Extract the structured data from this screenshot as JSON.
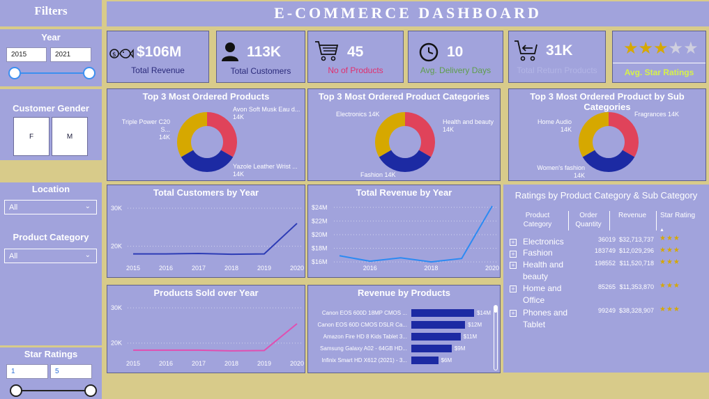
{
  "filters": {
    "title": "Filters",
    "year": {
      "label": "Year",
      "from": "2015",
      "to": "2021"
    },
    "gender": {
      "label": "Customer Gender",
      "options": [
        "F",
        "M"
      ]
    },
    "location": {
      "label": "Location",
      "value": "All"
    },
    "category": {
      "label": "Product Category",
      "value": "All"
    },
    "stars": {
      "label": "Star Ratings",
      "from": "1",
      "to": "5"
    }
  },
  "header": {
    "title": "E-COMMERCE DASHBOARD"
  },
  "kpis": [
    {
      "value": "$106M",
      "label": "Total Revenue",
      "icon": "fish-icon"
    },
    {
      "value": "113K",
      "label": "Total Customers",
      "icon": "user-icon"
    },
    {
      "value": "45",
      "label": "No of Products",
      "icon": "cart-icon"
    },
    {
      "value": "10",
      "label": "Avg. Delivery Days",
      "icon": "clock-icon"
    },
    {
      "value": "31K",
      "label": "Total Return Products",
      "icon": "return-cart-icon"
    },
    {
      "label": "Avg. Star Ratings",
      "stars_filled": 3,
      "stars_total": 5
    }
  ],
  "colors": {
    "panel": "#a1a3dc",
    "background": "#d8cb8a",
    "red": "#e0435a",
    "blue": "#1c2aa3",
    "gold": "#d6a800",
    "pink": "#e14eb0",
    "line_blue": "#2b8af3"
  },
  "donuts": [
    {
      "title": "Top 3 Most Ordered Products",
      "labels": [
        {
          "name": "Avon Soft Musk Eau d...",
          "value": "14K"
        },
        {
          "name": "Yazole Leather Wrist ...",
          "value": "14K"
        },
        {
          "name": "Triple Power C20 S...",
          "value": "14K"
        }
      ]
    },
    {
      "title": "Top 3 Most Ordered Product Categories",
      "labels": [
        {
          "name": "Health and beauty",
          "value": "14K"
        },
        {
          "name": "Fashion",
          "value": "14K"
        },
        {
          "name": "Electronics",
          "value": "14K"
        }
      ]
    },
    {
      "title": "Top 3 Most Ordered Product by Sub Categories",
      "labels": [
        {
          "name": "Fragrances",
          "value": "14K"
        },
        {
          "name": "Women's fashion",
          "value": "14K"
        },
        {
          "name": "Home Audio",
          "value": "14K"
        }
      ]
    }
  ],
  "chart_data": [
    {
      "type": "line",
      "title": "Total Customers by Year",
      "x": [
        2015,
        2016,
        2017,
        2018,
        2019,
        2020
      ],
      "series": [
        {
          "values": [
            18000,
            18000,
            18100,
            17900,
            18000,
            26000
          ]
        }
      ],
      "yticks": [
        "30K",
        "20K"
      ],
      "ylim": [
        15000,
        32000
      ],
      "color": "#2c3bb5"
    },
    {
      "type": "line",
      "title": "Total Revenue by Year",
      "x": [
        2015,
        2016,
        2017,
        2018,
        2019,
        2020
      ],
      "series": [
        {
          "values": [
            16.9,
            16.1,
            16.6,
            16.0,
            16.5,
            24.2
          ]
        }
      ],
      "yticks": [
        "$24M",
        "$22M",
        "$20M",
        "$18M",
        "$16M"
      ],
      "xticks": [
        "2016",
        "2018",
        "2020"
      ],
      "ylim": [
        15.5,
        25
      ],
      "color": "#2b8af3"
    },
    {
      "type": "line",
      "title": "Products Sold over Year",
      "x": [
        2015,
        2016,
        2017,
        2018,
        2019,
        2020
      ],
      "series": [
        {
          "values": [
            18000,
            18000,
            18000,
            17800,
            17900,
            25500
          ]
        }
      ],
      "yticks": [
        "30K",
        "20K"
      ],
      "ylim": [
        15000,
        32000
      ],
      "color": "#e14eb0"
    },
    {
      "type": "bar",
      "title": "Revenue by Products",
      "categories": [
        "Canon EOS 600D 18MP CMOS ...",
        "Canon EOS 60D CMOS DSLR Ca...",
        "Amazon Fire HD 8 Kids Tablet 3...",
        "Samsung Galaxy A02 - 64GB HD...",
        "Infinix Smart HD X612 (2021) - 3..."
      ],
      "values": [
        14,
        12,
        11,
        9,
        6
      ],
      "labels": [
        "$14M",
        "$12M",
        "$11M",
        "$9M",
        "$6M"
      ]
    }
  ],
  "ratings_table": {
    "title": "Ratings by Product Category & Sub Category",
    "columns": [
      "Product Category",
      "Order Quantity",
      "Revenue",
      "Star Rating"
    ],
    "rows": [
      {
        "category": "Electronics",
        "qty": "36019",
        "revenue": "$32,713,737",
        "stars": "★★★"
      },
      {
        "category": "Fashion",
        "qty": "183749",
        "revenue": "$12,029,296",
        "stars": "★★★"
      },
      {
        "category": "Health and beauty",
        "qty": "198552",
        "revenue": "$11,520,718",
        "stars": "★★★"
      },
      {
        "category": "Home and Office",
        "qty": "85265",
        "revenue": "$11,353,870",
        "stars": "★★★"
      },
      {
        "category": "Phones and Tablet",
        "qty": "99249",
        "revenue": "$38,328,907",
        "stars": "★★★"
      }
    ]
  }
}
